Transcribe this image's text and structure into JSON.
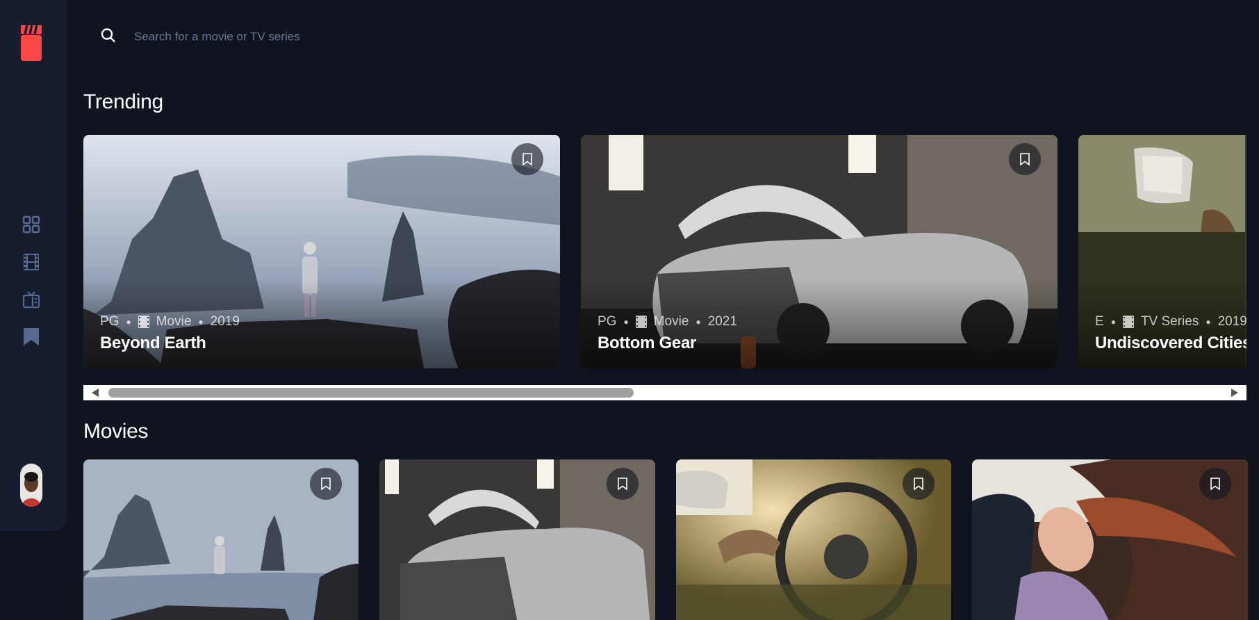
{
  "app": {
    "logo_icon": "clapperboard-icon",
    "accent": "#FC4747",
    "background": "#10141E",
    "sidebar_background": "#161D2F"
  },
  "nav": {
    "items": [
      {
        "name": "home",
        "icon": "grid-icon"
      },
      {
        "name": "movies",
        "icon": "film-icon"
      },
      {
        "name": "tv-series",
        "icon": "tv-icon"
      },
      {
        "name": "bookmarks",
        "icon": "bookmark-icon"
      }
    ],
    "avatar_icon": "user-avatar"
  },
  "search": {
    "placeholder": "Search for a movie or TV series",
    "value": "",
    "icon": "search-icon"
  },
  "trending": {
    "heading": "Trending",
    "items": [
      {
        "title": "Beyond Earth",
        "rating": "PG",
        "category": "Movie",
        "year": "2019",
        "category_icon": "film-icon"
      },
      {
        "title": "Bottom Gear",
        "rating": "PG",
        "category": "Movie",
        "year": "2021",
        "category_icon": "film-icon"
      },
      {
        "title": "Undiscovered Cities",
        "rating": "E",
        "category": "TV Series",
        "year": "2019",
        "category_icon": "tv-icon"
      }
    ]
  },
  "movies": {
    "heading": "Movies",
    "items": [
      {
        "image": "sea-stacks-hiker"
      },
      {
        "image": "car-in-garage"
      },
      {
        "image": "driver-steering-wheel"
      },
      {
        "image": "woman-wind-hair"
      }
    ]
  }
}
